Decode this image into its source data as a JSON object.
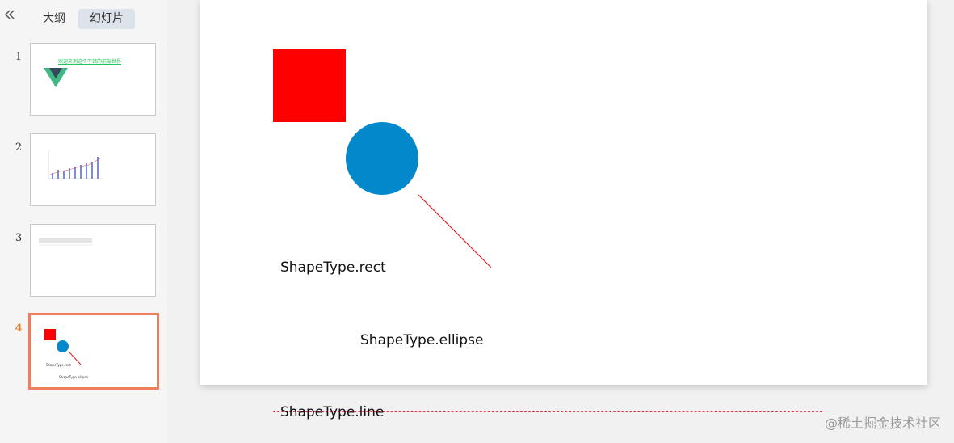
{
  "sidebar": {
    "tabs": [
      {
        "label": "大纲"
      },
      {
        "label": "幻灯片"
      }
    ],
    "slides": [
      {
        "number": "1",
        "title": "欢迎来到这个不错的前端世界"
      },
      {
        "number": "2"
      },
      {
        "number": "3"
      },
      {
        "number": "4",
        "rect_label": "ShapeType.rect",
        "ellipse_label": "ShapeType.ellipse"
      }
    ]
  },
  "slide": {
    "shapes": {
      "rect_color": "#ff0000",
      "ellipse_color": "#0388cc",
      "line_color": "#e02020"
    },
    "labels": {
      "rect": "ShapeType.rect",
      "ellipse": "ShapeType.ellipse",
      "line": "ShapeType.line"
    }
  },
  "watermark": "@稀土掘金技术社区",
  "icons": {
    "collapse": "double-chevron-left-icon"
  }
}
